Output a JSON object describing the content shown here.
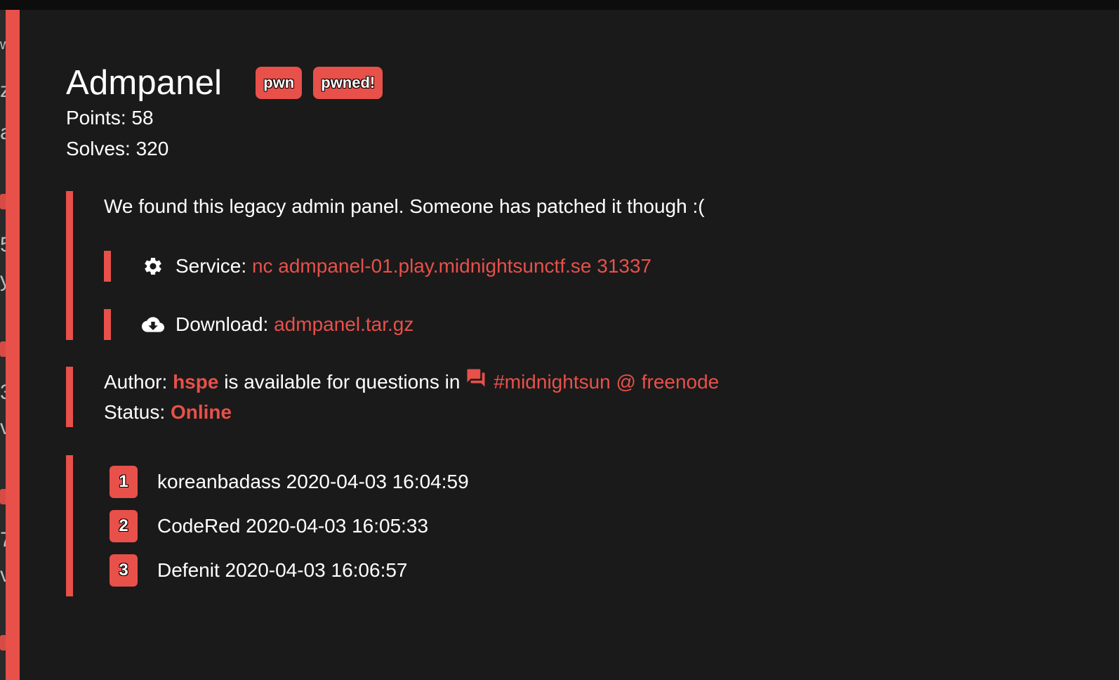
{
  "challenge": {
    "title": "Admpanel",
    "tags": [
      "pwn",
      "pwned!"
    ],
    "points_label": "Points: 58",
    "solves_label": "Solves: 320",
    "description": "We found this legacy admin panel. Someone has patched it though :(",
    "service": {
      "label": "Service:",
      "value": "nc admpanel-01.play.midnightsunctf.se 31337",
      "icon": "gear-icon"
    },
    "download": {
      "label": "Download:",
      "value": "admpanel.tar.gz",
      "icon": "cloud-download-icon"
    },
    "author": {
      "prefix": "Author:",
      "name": "hspe",
      "middle": "is available for questions in",
      "channel": "#midnightsun @ freenode",
      "channel_icon": "chat-icon"
    },
    "status": {
      "label": "Status:",
      "value": "Online"
    },
    "solvers": [
      {
        "rank": "1",
        "text": "koreanbadass 2020-04-03 16:04:59"
      },
      {
        "rank": "2",
        "text": "CodeRed 2020-04-03 16:05:33"
      },
      {
        "rank": "3",
        "text": "Defenit 2020-04-03 16:06:57"
      }
    ]
  },
  "colors": {
    "accent": "#e8504a",
    "modal_bg": "#1a1a1a",
    "page_bg": "#0d0d0d",
    "text": "#ffffff"
  }
}
